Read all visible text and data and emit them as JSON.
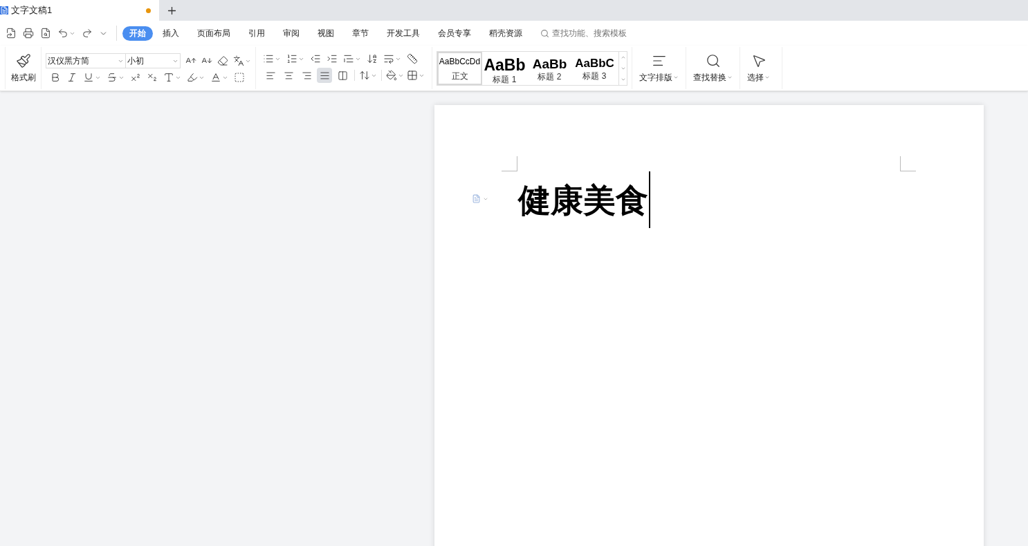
{
  "document_tab": {
    "title": "文字文稿1",
    "modified": true
  },
  "menu_tabs": [
    {
      "label": "开始",
      "selected": true
    },
    {
      "label": "插入",
      "selected": false
    },
    {
      "label": "页面布局",
      "selected": false
    },
    {
      "label": "引用",
      "selected": false
    },
    {
      "label": "审阅",
      "selected": false
    },
    {
      "label": "视图",
      "selected": false
    },
    {
      "label": "章节",
      "selected": false
    },
    {
      "label": "开发工具",
      "selected": false
    },
    {
      "label": "会员专享",
      "selected": false
    },
    {
      "label": "稻壳资源",
      "selected": false
    }
  ],
  "search": {
    "placeholder": "查找功能、搜索模板"
  },
  "ribbon": {
    "format_painter": "格式刷",
    "font_name": "汉仪黑方简",
    "font_size": "小初",
    "alignments": [
      {
        "kind": "left",
        "selected": false
      },
      {
        "kind": "center",
        "selected": false
      },
      {
        "kind": "right",
        "selected": false
      },
      {
        "kind": "justify",
        "selected": true
      },
      {
        "kind": "distributed",
        "selected": false
      }
    ],
    "styles": [
      {
        "kind": "body",
        "preview": "AaBbCcDd",
        "label": "正文",
        "selected": true
      },
      {
        "kind": "h1",
        "preview": "AaBb",
        "label": "标题 1",
        "selected": false
      },
      {
        "kind": "h2",
        "preview": "AaBb",
        "label": "标题 2",
        "selected": false
      },
      {
        "kind": "h3",
        "preview": "AaBbC",
        "label": "标题 3",
        "selected": false
      }
    ],
    "text_layout": "文字排版",
    "find_replace": "查找替换",
    "select": "选择"
  },
  "document": {
    "heading": "健康美食"
  }
}
